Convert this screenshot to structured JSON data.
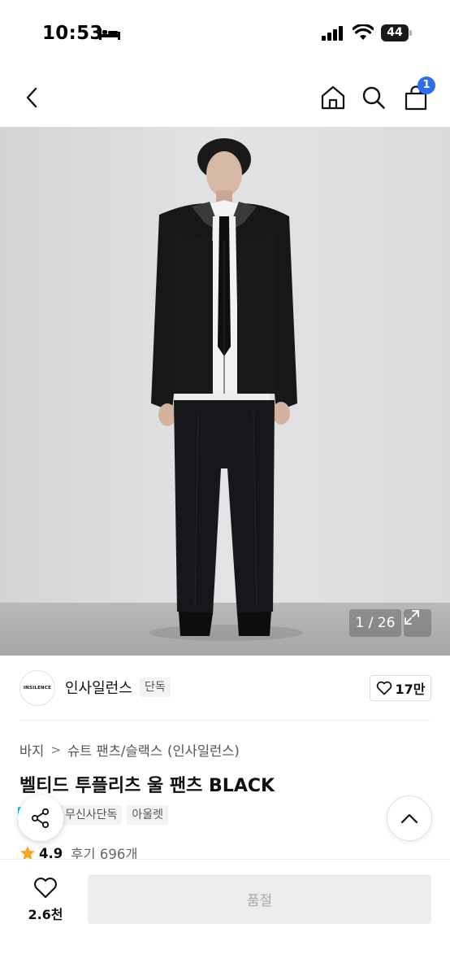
{
  "status_bar": {
    "time": "10:53",
    "battery": "44",
    "icons": [
      "bed-icon",
      "signal-icon",
      "wifi-icon",
      "battery-icon"
    ]
  },
  "header": {
    "icons": [
      "back-arrow-icon",
      "home-icon",
      "search-icon",
      "cart-icon"
    ],
    "cart_badge": "1",
    "accent_color": "#2f6df0"
  },
  "gallery": {
    "counter": "1 / 26",
    "expand_icon": "expand-icon"
  },
  "brand": {
    "logo_text": "INSILENCE",
    "name": "인사일런스",
    "tag": "단독",
    "like_count": "17만"
  },
  "breadcrumb": {
    "items": [
      "바지",
      "슈트 팬츠/슬랙스",
      "(인사일런스)"
    ]
  },
  "product": {
    "title": "벨티드 투플리츠 울 팬츠 BLACK",
    "tags": [
      "무신사단독",
      "아울렛"
    ],
    "rating": "4.9",
    "reviews": "후기 696개",
    "star_color": "#f5a623"
  },
  "bottom_bar": {
    "wish_count": "2.6천",
    "buy_label": "품절"
  }
}
